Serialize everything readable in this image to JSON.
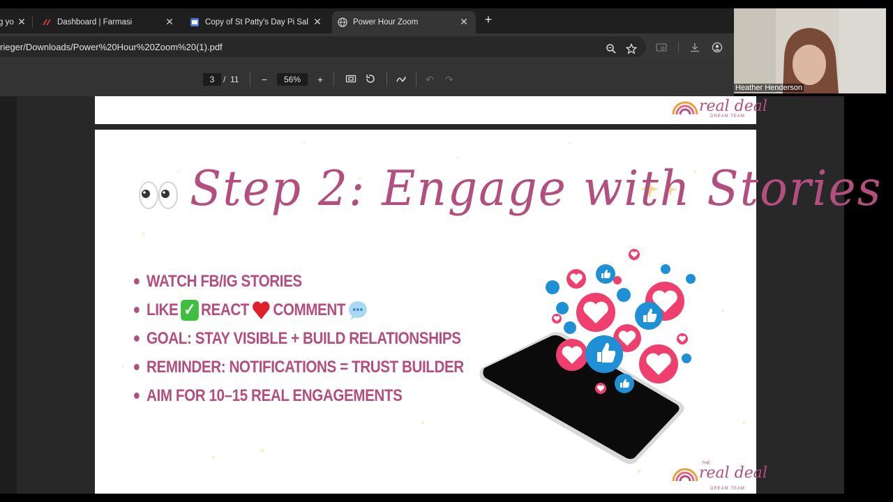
{
  "browser": {
    "tabs": [
      {
        "label": "g yo",
        "active": false
      },
      {
        "label": "Dashboard | Farmasi",
        "active": false
      },
      {
        "label": "Copy of St Patty's Day Pi Sale",
        "active": false
      },
      {
        "label": "Power Hour Zoom",
        "active": true
      }
    ],
    "url": "rieger/Downloads/Power%20Hour%20Zoom%20(1).pdf"
  },
  "pdf_toolbar": {
    "current_page": "3",
    "page_separator": "/",
    "total_pages": "11",
    "zoom": "56%"
  },
  "slide": {
    "title": "Step 2: Engage with Stories",
    "bullets": {
      "b1": "WATCH FB/IG STORIES",
      "b2_like": "LIKE",
      "b2_react": "REACT",
      "b2_comment": "COMMENT",
      "b3": "GOAL: STAY VISIBLE + BUILD RELATIONSHIPS",
      "b4": "REMINDER: NOTIFICATIONS = TRUST BUILDER",
      "b5": "AIM FOR 10–15 REAL ENGAGEMENTS"
    },
    "logo": {
      "the": "THE",
      "brand": "real deal",
      "sub": "DREAM TEAM"
    },
    "colors": {
      "accent": "#b24f7f",
      "like_blue": "#1f8fd6",
      "heart_pink": "#ef3f6e"
    }
  },
  "webcam": {
    "participant_name": "Heather Henderson"
  }
}
